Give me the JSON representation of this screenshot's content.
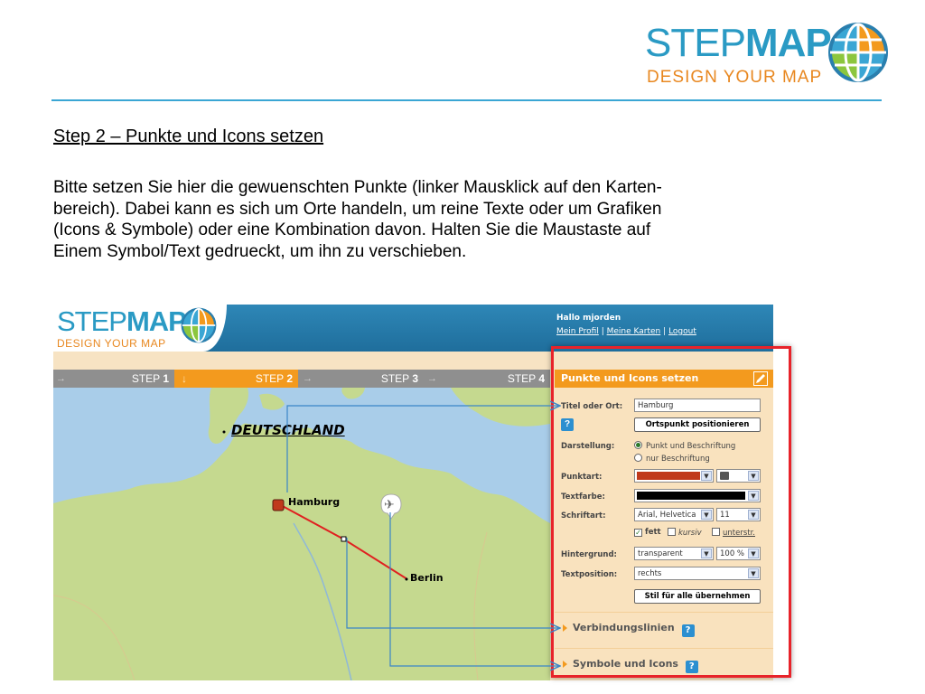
{
  "header": {
    "logo_word_a": "STEP",
    "logo_word_b": "MAP",
    "logo_tagline": "DESIGN YOUR MAP"
  },
  "slide": {
    "title": "Step 2 – Punkte und Icons setzen",
    "lines": [
      "Bitte setzen Sie hier die gewuenschten Punkte (linker Mausklick auf den Karten-",
      "bereich). Dabei kann es sich um Orte handeln, um reine Texte oder um Grafiken",
      "(Icons & Symbole) oder eine Kombination davon. Halten Sie die Maustaste auf",
      "Einem Symbol/Text gedrueckt, um ihn zu verschieben."
    ]
  },
  "app": {
    "logo_word_a": "STEP",
    "logo_word_b": "MAP",
    "logo_tagline": "DESIGN YOUR MAP",
    "greeting": "Hallo mjorden",
    "links": [
      "Mein Profil",
      "Meine Karten",
      "Logout"
    ],
    "link_sep": "|",
    "steps": [
      {
        "label": "STEP",
        "num": "1"
      },
      {
        "label": "STEP",
        "num": "2"
      },
      {
        "label": "STEP",
        "num": "3"
      },
      {
        "label": "STEP",
        "num": "4"
      }
    ],
    "active_step": 2
  },
  "map": {
    "country_label": "DEUTSCHLAND",
    "city1": "Hamburg",
    "city2": "Berlin",
    "colors": {
      "land": "#c5d98f",
      "sea": "#a9cde9",
      "route": "#e02020",
      "marker": "#c0391b"
    }
  },
  "panel": {
    "header": "Punkte und Icons setzen",
    "title_label": "Titel oder Ort:",
    "title_value": "Hamburg",
    "help": "?",
    "position_button": "Ortspunkt positionieren",
    "display_label": "Darstellung:",
    "display_opt1": "Punkt und Beschriftung",
    "display_opt2": "nur Beschriftung",
    "pointtype_label": "Punktart:",
    "textcolor_label": "Textfarbe:",
    "font_label": "Schriftart:",
    "font_value": "Arial, Helvetica",
    "font_size": "11",
    "bold_label": "fett",
    "italic_label": "kursiv",
    "underline_label": "unterstr.",
    "background_label": "Hintergrund:",
    "background_value": "transparent",
    "opacity_value": "100 %",
    "textpos_label": "Textposition:",
    "textpos_value": "rechts",
    "apply_button": "Stil für alle übernehmen",
    "section1": "Verbindungslinien",
    "section2": "Symbole und Icons",
    "point_color": "#c0391b",
    "text_color": "#000000",
    "accent": "#f39a1e"
  }
}
